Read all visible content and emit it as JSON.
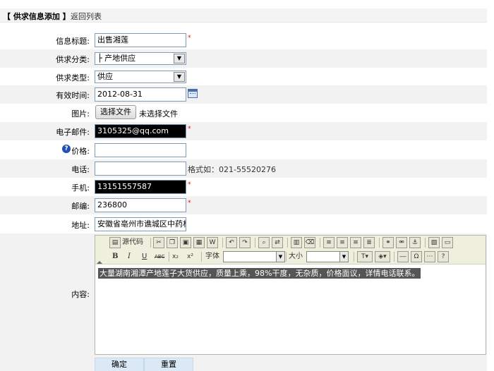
{
  "header": {
    "title": "【 供求信息添加 】",
    "back_link": "返回列表"
  },
  "form": {
    "title": {
      "label": "信息标题:",
      "value": "出售湘莲",
      "required": "*"
    },
    "category": {
      "label": "供求分类:",
      "value": "├ 产地供应"
    },
    "type": {
      "label": "供求类型:",
      "value": "供应"
    },
    "valid_time": {
      "label": "有效时间:",
      "value": "2012-08-31"
    },
    "image": {
      "label": "图片:",
      "button": "选择文件",
      "status": "未选择文件"
    },
    "email": {
      "label": "电子邮件:",
      "value": "3105325@qq.com",
      "required": "*"
    },
    "price": {
      "label": "价格:",
      "value": ""
    },
    "phone": {
      "label": "电话:",
      "value": "",
      "hint": "格式如：021-55520276"
    },
    "mobile": {
      "label": "手机:",
      "value": "13151557587",
      "required": "*"
    },
    "zipcode": {
      "label": "邮编:",
      "value": "236800",
      "required": "*"
    },
    "address": {
      "label": "地址:",
      "value": "安徽省亳州市谯城区中药材"
    },
    "content": {
      "label": "内容:",
      "text": "大量湖南湘潭产地莲子大货供应，质量上乘，98%干度，无杂质，价格面议，详情电话联系。"
    }
  },
  "editor": {
    "source_label": "源代码",
    "font_label": "字体",
    "size_label": "大小",
    "bold": "B",
    "italic": "I",
    "underline": "U",
    "strike": "ABC",
    "subscript": "x₂",
    "superscript": "x²"
  },
  "buttons": {
    "submit": "确定",
    "reset": "重置"
  }
}
